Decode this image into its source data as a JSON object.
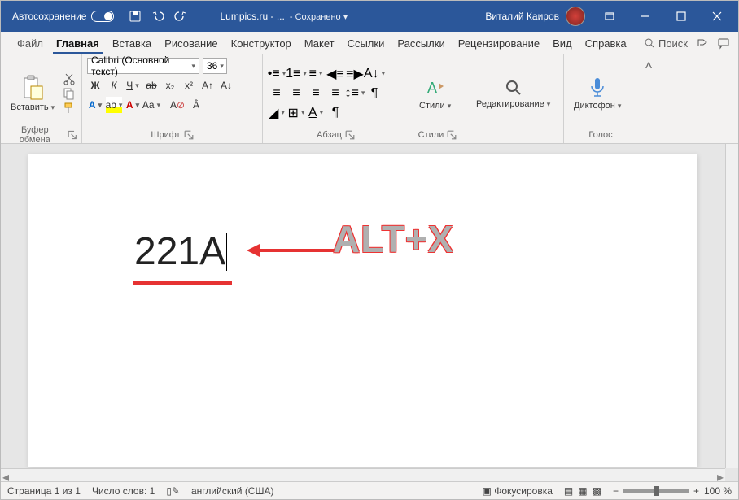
{
  "titlebar": {
    "autosave": "Автосохранение",
    "doc_name": "Lumpics.ru - ...",
    "saved": "Сохранено",
    "user": "Виталий Каиров"
  },
  "tabs": {
    "file": "Файл",
    "items": [
      "Главная",
      "Вставка",
      "Рисование",
      "Конструктор",
      "Макет",
      "Ссылки",
      "Рассылки",
      "Рецензирование",
      "Вид",
      "Справка"
    ],
    "search": "Поиск"
  },
  "ribbon": {
    "clipboard": {
      "paste": "Вставить",
      "label": "Буфер обмена"
    },
    "font": {
      "name": "Calibri (Основной текст)",
      "size": "36",
      "bold": "Ж",
      "italic": "К",
      "underline": "Ч",
      "strike": "ab",
      "sub": "x₂",
      "sup": "x²",
      "aa": "Aa",
      "clear": "A",
      "label": "Шрифт"
    },
    "paragraph": {
      "label": "Абзац"
    },
    "styles": {
      "btn": "Стили",
      "label": "Стили"
    },
    "editing": {
      "btn": "Редактирование"
    },
    "voice": {
      "btn": "Диктофон",
      "label": "Голос"
    }
  },
  "document": {
    "text": "221A",
    "annotation": "ALT+X"
  },
  "status": {
    "page": "Страница 1 из 1",
    "words": "Число слов: 1",
    "lang": "английский (США)",
    "focus": "Фокусировка",
    "zoom_minus": "−",
    "zoom_plus": "+",
    "zoom": "100 %"
  }
}
